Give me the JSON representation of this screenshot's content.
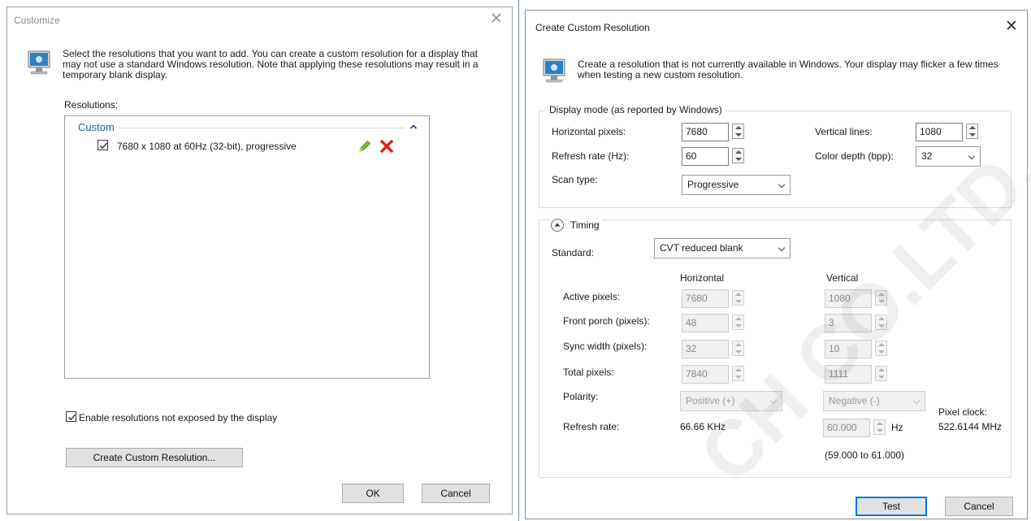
{
  "customize": {
    "title": "Customize",
    "description": "Select the resolutions that you want to add. You can create a custom resolution for a display that may not use a standard Windows resolution. Note that applying these resolutions may result in a temporary blank display.",
    "resolutions_label": "Resolutions:",
    "group_name": "Custom",
    "items": [
      {
        "label": "7680 x 1080 at 60Hz (32-bit), progressive",
        "checked": true
      }
    ],
    "enable_label": "Enable resolutions not exposed by the display",
    "enable_checked": true,
    "create_button": "Create Custom Resolution...",
    "ok_button": "OK",
    "cancel_button": "Cancel"
  },
  "create": {
    "title": "Create Custom Resolution",
    "description": "Create a resolution that is not currently available in Windows. Your display may flicker a few times when testing a new custom resolution.",
    "display_mode_label": "Display mode (as reported by Windows)",
    "horizontal_pixels_label": "Horizontal pixels:",
    "horizontal_pixels": "7680",
    "vertical_lines_label": "Vertical lines:",
    "vertical_lines": "1080",
    "refresh_rate_label": "Refresh rate (Hz):",
    "refresh_rate": "60",
    "color_depth_label": "Color depth (bpp):",
    "color_depth": "32",
    "scan_type_label": "Scan type:",
    "scan_type": "Progressive",
    "timing_label": "Timing",
    "standard_label": "Standard:",
    "standard": "CVT reduced blank",
    "col_horizontal": "Horizontal",
    "col_vertical": "Vertical",
    "rows": [
      {
        "label": "Active pixels:",
        "h": "7680",
        "v": "1080"
      },
      {
        "label": "Front porch (pixels):",
        "h": "48",
        "v": "3"
      },
      {
        "label": "Sync width (pixels):",
        "h": "32",
        "v": "10"
      },
      {
        "label": "Total pixels:",
        "h": "7840",
        "v": "1111"
      }
    ],
    "polarity_label": "Polarity:",
    "polarity_h": "Positive (+)",
    "polarity_v": "Negative (-)",
    "refresh_label": "Refresh rate:",
    "refresh_h": "66.66 KHz",
    "refresh_v": "60.000",
    "refresh_v_unit": "Hz",
    "refresh_range": "(59.000 to 61.000)",
    "pixel_clock_label": "Pixel clock:",
    "pixel_clock": "522.6144 MHz",
    "test_button": "Test",
    "cancel_button": "Cancel"
  },
  "watermark": "CH CO.LTD."
}
